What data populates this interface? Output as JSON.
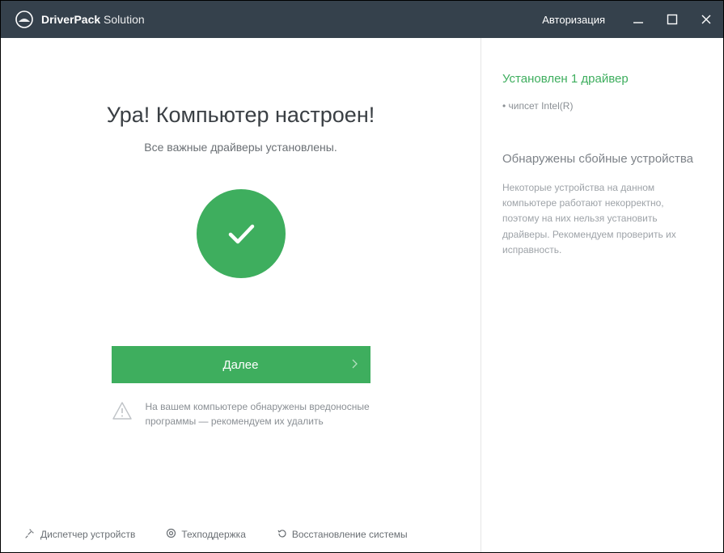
{
  "titlebar": {
    "brand_strong": "DriverPack",
    "brand_light": " Solution",
    "auth_label": "Авторизация"
  },
  "main": {
    "heading": "Ура! Компьютер настроен!",
    "subheading": "Все важные драйверы установлены.",
    "next_label": "Далее",
    "warning_text": "На вашем компьютере обнаружены вредоносные программы — рекомендуем их удалить"
  },
  "footer": {
    "devmgr": "Диспетчер устройств",
    "support": "Техподдержка",
    "restore": "Восстановление системы"
  },
  "sidebar": {
    "installed_title": "Установлен 1 драйвер",
    "installed_item": "• чипсет Intel(R)",
    "failed_title": "Обнаружены сбойные устройства",
    "failed_desc": "Некоторые устройства на данном компьютере работают некорректно, поэтому на них нельзя установить драйверы. Рекомендуем проверить их исправность."
  },
  "colors": {
    "accent": "#3eae5e",
    "titlebar": "#35414c"
  }
}
